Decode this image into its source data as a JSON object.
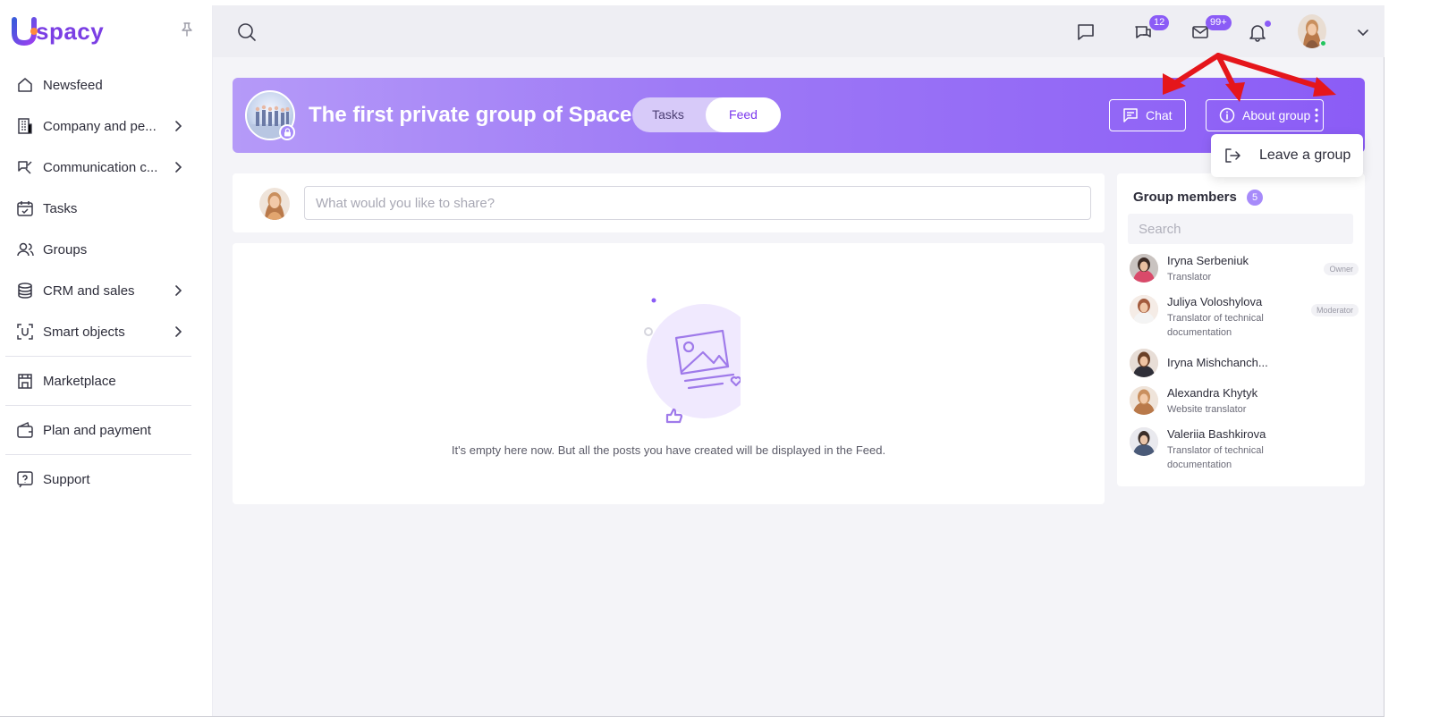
{
  "brand": {
    "logo_text": "spacy",
    "accent": "#8b5cf6"
  },
  "sidebar": {
    "items": [
      {
        "label": "Newsfeed",
        "icon": "home-icon",
        "has_submenu": false
      },
      {
        "label": "Company and pe...",
        "icon": "building-icon",
        "has_submenu": true
      },
      {
        "label": "Communication c...",
        "icon": "communication-icon",
        "has_submenu": true
      },
      {
        "label": "Tasks",
        "icon": "calendar-check-icon",
        "has_submenu": false
      },
      {
        "label": "Groups",
        "icon": "users-icon",
        "has_submenu": false
      },
      {
        "label": "CRM and sales",
        "icon": "database-icon",
        "has_submenu": true
      },
      {
        "label": "Smart objects",
        "icon": "smart-object-icon",
        "has_submenu": true
      },
      {
        "label": "Marketplace",
        "icon": "store-icon",
        "has_submenu": false
      },
      {
        "label": "Plan and payment",
        "icon": "wallet-icon",
        "has_submenu": false
      },
      {
        "label": "Support",
        "icon": "help-icon",
        "has_submenu": false
      }
    ]
  },
  "topbar": {
    "chat_badge": "12",
    "mail_badge": "99+"
  },
  "group": {
    "title": "The first private group of Space",
    "tabs": [
      {
        "label": "Tasks",
        "active": false
      },
      {
        "label": "Feed",
        "active": true
      }
    ],
    "chat_label": "Chat",
    "about_label": "About group",
    "menu": {
      "leave_label": "Leave a group"
    }
  },
  "composer": {
    "placeholder": "What would you like to share?"
  },
  "feed": {
    "empty_text": "It's empty here now. But all the posts you have created will be displayed in the Feed."
  },
  "members": {
    "title": "Group members",
    "count": "5",
    "search_placeholder": "Search",
    "list": [
      {
        "name": "Iryna Serbeniuk",
        "role": "Translator",
        "tag": "Owner"
      },
      {
        "name": "Juliya Voloshylova",
        "role": "Translator of technical documentation",
        "tag": "Moderator"
      },
      {
        "name": "Iryna Mishchanch...",
        "role": "",
        "tag": ""
      },
      {
        "name": "Alexandra Khytyk",
        "role": "Website translator",
        "tag": ""
      },
      {
        "name": "Valeriia Bashkirova",
        "role": "Translator of technical documentation",
        "tag": ""
      }
    ]
  }
}
